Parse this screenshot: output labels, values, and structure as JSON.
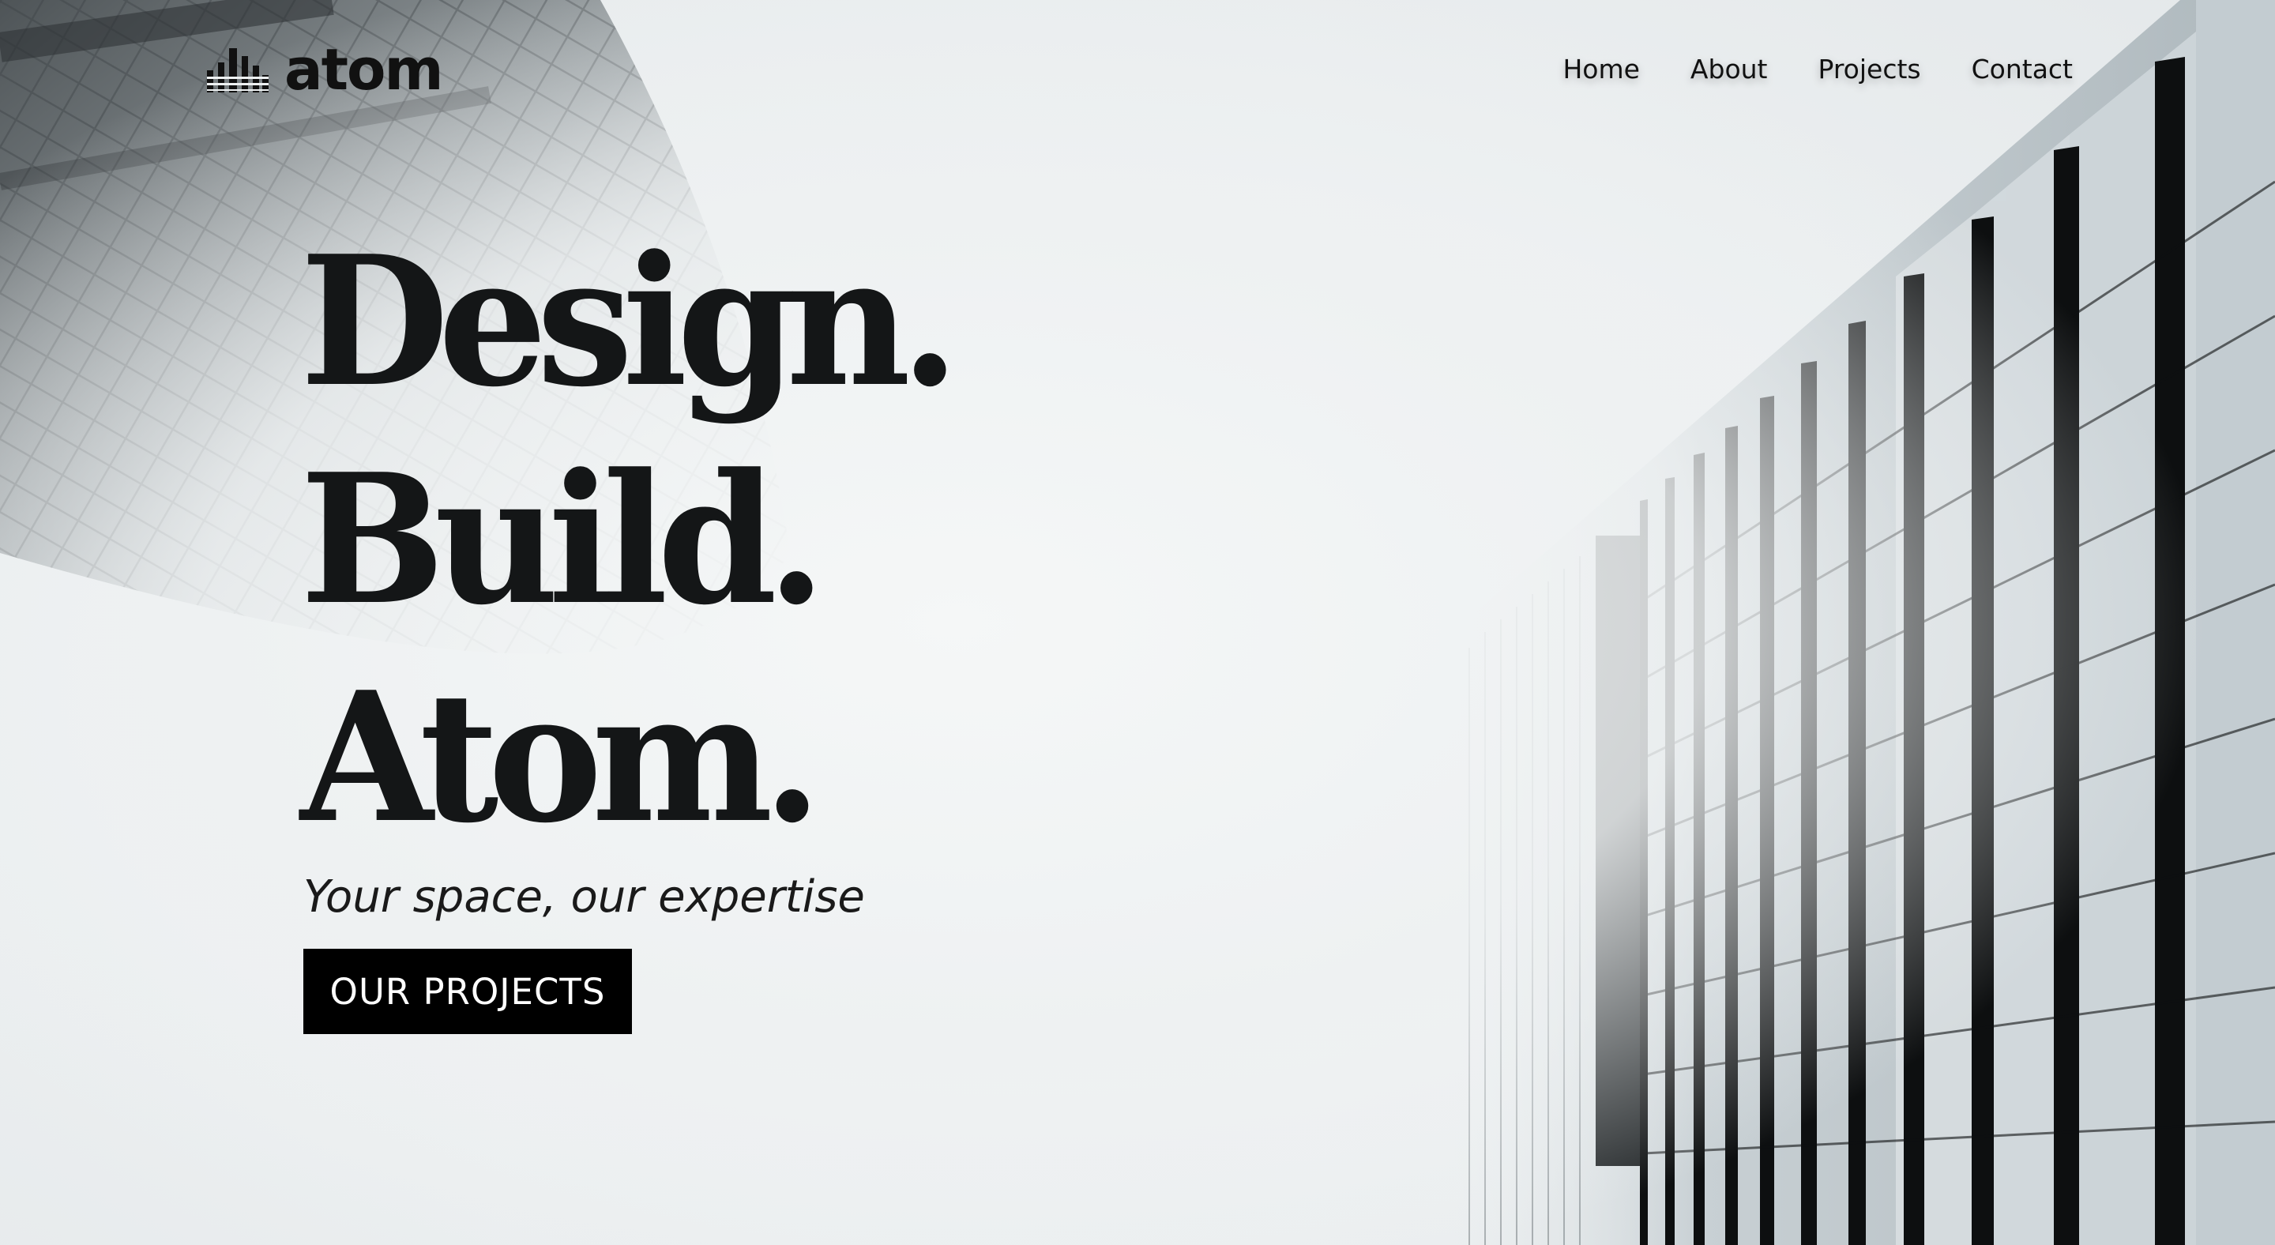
{
  "brand": {
    "name": "atom",
    "logo_icon": "building-bars-icon"
  },
  "nav": {
    "items": [
      {
        "label": "Home"
      },
      {
        "label": "About"
      },
      {
        "label": "Projects"
      },
      {
        "label": "Contact"
      }
    ]
  },
  "hero": {
    "headline": [
      "Design.",
      "Build.",
      "Atom."
    ],
    "tagline": "Your space, our expertise",
    "cta_label": "OUR PROJECTS",
    "background_image": "skyscrapers-fog-photo"
  },
  "colors": {
    "text": "#141617",
    "button_bg": "#000000",
    "button_text": "#ffffff",
    "background": "#eef1f2"
  }
}
